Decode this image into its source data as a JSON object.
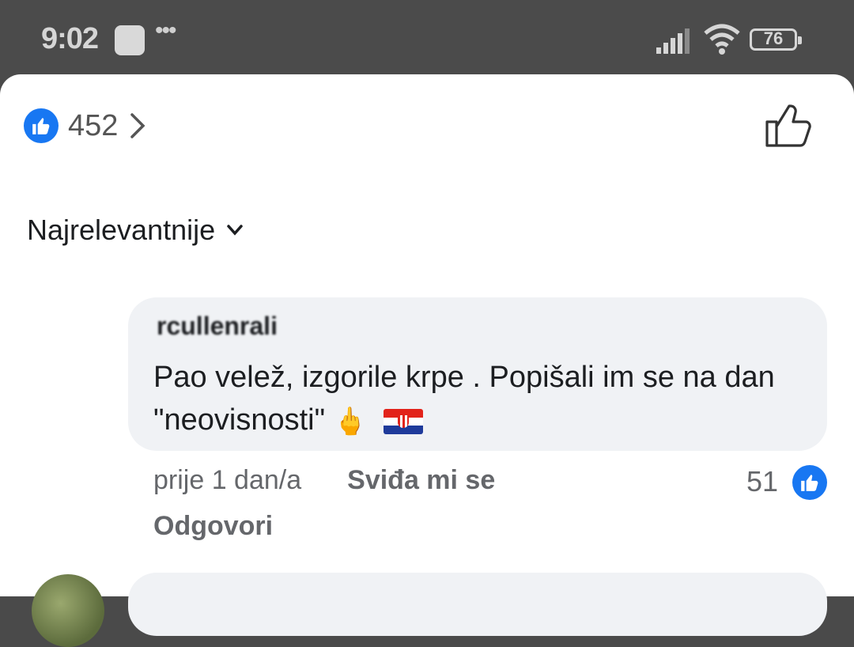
{
  "status_bar": {
    "time": "9:02",
    "dots": "•••",
    "battery": "76",
    "icons": [
      "signal-icon",
      "wifi-icon",
      "battery-icon"
    ]
  },
  "reactions": {
    "count": "452",
    "icon": "like-reaction-icon"
  },
  "sort": {
    "label": "Najrelevantnije"
  },
  "comment": {
    "author": "rcullenrali",
    "text": "Pao velež, izgorile krpe . Popišali im se na dan \"neovisnosti\"",
    "emoji_finger": "🖕",
    "time": "prije 1 dan/a",
    "like_action": "Sviđa mi se",
    "reply_action": "Odgovori",
    "likes": "51"
  },
  "colors": {
    "accent": "#1877f2",
    "bubble": "#f0f2f5",
    "meta": "#65676b"
  }
}
